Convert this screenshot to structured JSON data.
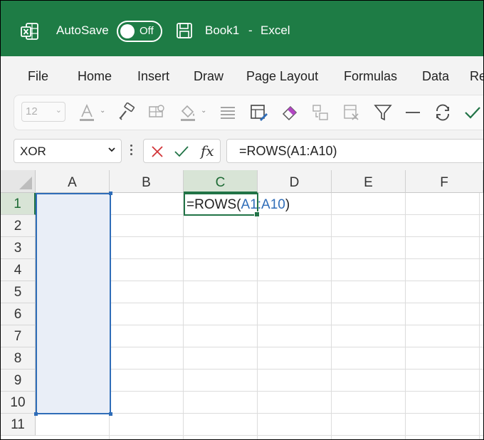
{
  "titlebar": {
    "autosave_label": "AutoSave",
    "toggle_state": "Off",
    "document_name": "Book1",
    "separator": "-",
    "app_name": "Excel",
    "background_color": "#1e7c45"
  },
  "menu": {
    "items": [
      "File",
      "Home",
      "Insert",
      "Draw",
      "Page Layout",
      "Formulas",
      "Data",
      "Re"
    ]
  },
  "ribbon": {
    "font_size": "12",
    "icons": [
      "font-color-icon",
      "format-painter-icon",
      "cell-styles-icon",
      "fill-color-icon",
      "align-icon",
      "conditional-format-icon",
      "clear-format-icon",
      "transform-icon",
      "delete-cells-icon",
      "filter-icon",
      "minus-icon",
      "refresh-icon",
      "check-icon"
    ]
  },
  "formula_bar": {
    "name_box": "XOR",
    "fx_label": "fx",
    "formula": "=ROWS(A1:A10)"
  },
  "grid": {
    "columns": [
      "A",
      "B",
      "C",
      "D",
      "E",
      "F"
    ],
    "rows": [
      "1",
      "2",
      "3",
      "4",
      "5",
      "6",
      "7",
      "8",
      "9",
      "10",
      "11"
    ],
    "selected_column": "C",
    "selected_row": "1",
    "active_cell": "C1",
    "highlighted_range": "A1:A10",
    "cell_c1": {
      "prefix": "=ROWS(",
      "reference": "A1:A10",
      "suffix": ")"
    },
    "accent_green": "#217346",
    "range_blue": "#2f6db8"
  }
}
